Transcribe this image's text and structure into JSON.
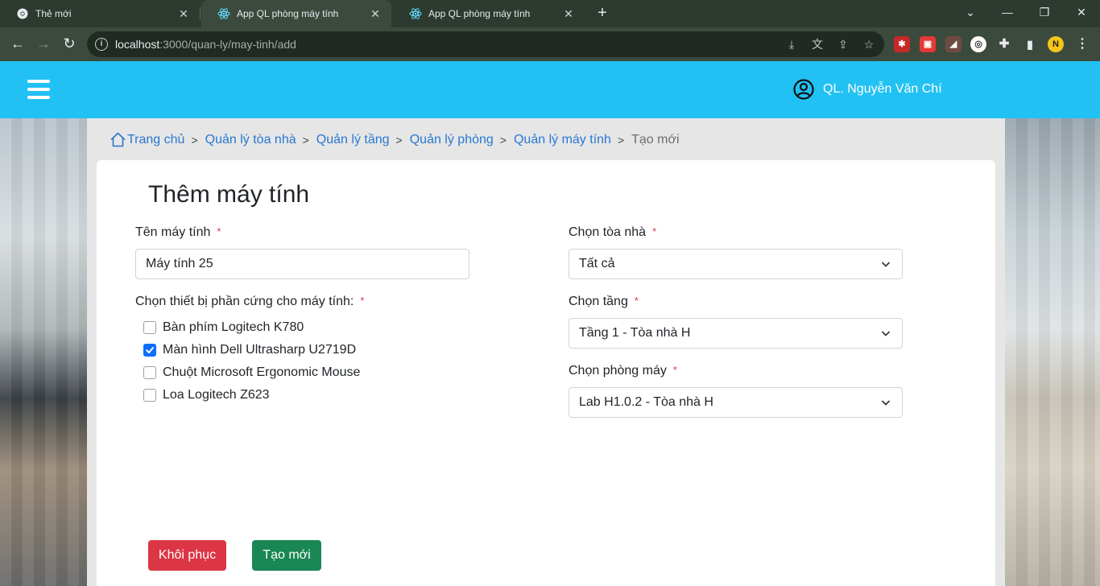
{
  "browser": {
    "tabs": [
      {
        "title": "Thẻ mới"
      },
      {
        "title": "App QL phòng máy tính"
      },
      {
        "title": "App QL phòng máy tính"
      }
    ],
    "url_host": "localhost",
    "url_path": ":3000/quan-ly/may-tinh/add"
  },
  "header": {
    "user_name": "QL. Nguyễn Văn Chí"
  },
  "breadcrumb": {
    "home": "Trang chủ",
    "buildings": "Quản lý tòa nhà",
    "floors": "Quản lý tầng",
    "rooms": "Quản lý phòng",
    "computers": "Quản lý máy tính",
    "current": "Tạo mới"
  },
  "form": {
    "title": "Thêm máy tính",
    "name_label": "Tên máy tính",
    "name_value": "Máy tính 25",
    "hardware_label": "Chọn thiết bị phần cứng cho máy tính:",
    "hardware": [
      {
        "label": "Bàn phím Logitech K780",
        "checked": false
      },
      {
        "label": "Màn hình Dell Ultrasharp U2719D",
        "checked": true
      },
      {
        "label": "Chuột Microsoft Ergonomic Mouse",
        "checked": false
      },
      {
        "label": "Loa Logitech Z623",
        "checked": false
      }
    ],
    "building_label": "Chọn tòa nhà",
    "building_value": "Tất cả",
    "floor_label": "Chọn tầng",
    "floor_value": "Tầng 1 - Tòa nhà H",
    "room_label": "Chọn phòng máy",
    "room_value": "Lab H1.0.2 - Tòa nhà H",
    "required_mark": "*",
    "reset_label": "Khôi phục",
    "create_label": "Tạo mới"
  },
  "colors": {
    "header": "#21c1f3",
    "link": "#2878d2",
    "danger": "#dc3545",
    "success": "#198754",
    "checkbox": "#0d6efd"
  }
}
